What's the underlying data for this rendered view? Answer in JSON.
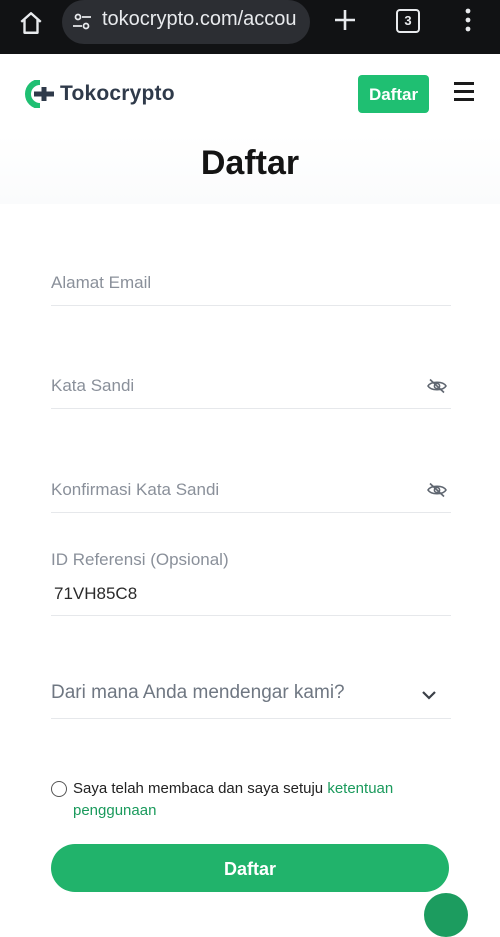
{
  "browser": {
    "url": "tokocrypto.com/accou",
    "tab_count": "3",
    "icons": [
      "home-icon",
      "site-settings-icon",
      "plus-icon",
      "tabs-icon",
      "more-vert-icon"
    ]
  },
  "header": {
    "brand": "Tokocrypto",
    "signup_button": "Daftar",
    "menu_icon": "hamburger-icon"
  },
  "page": {
    "title": "Daftar"
  },
  "form": {
    "email_placeholder": "Alamat Email",
    "password_placeholder": "Kata Sandi",
    "confirm_password_placeholder": "Konfirmasi Kata Sandi",
    "referral_label": "ID Referensi (Opsional)",
    "referral_value": "71VH85C8",
    "source_select": "Dari mana Anda mendengar kami?",
    "terms_text": "Saya telah membaca dan saya setuju ",
    "terms_link": "ketentuan penggunaan",
    "terms_checked": false,
    "submit_label": "Daftar"
  },
  "colors": {
    "brand_green": "#1fbf72",
    "link_green": "#1a9a5c",
    "browser_bg": "#111214"
  }
}
